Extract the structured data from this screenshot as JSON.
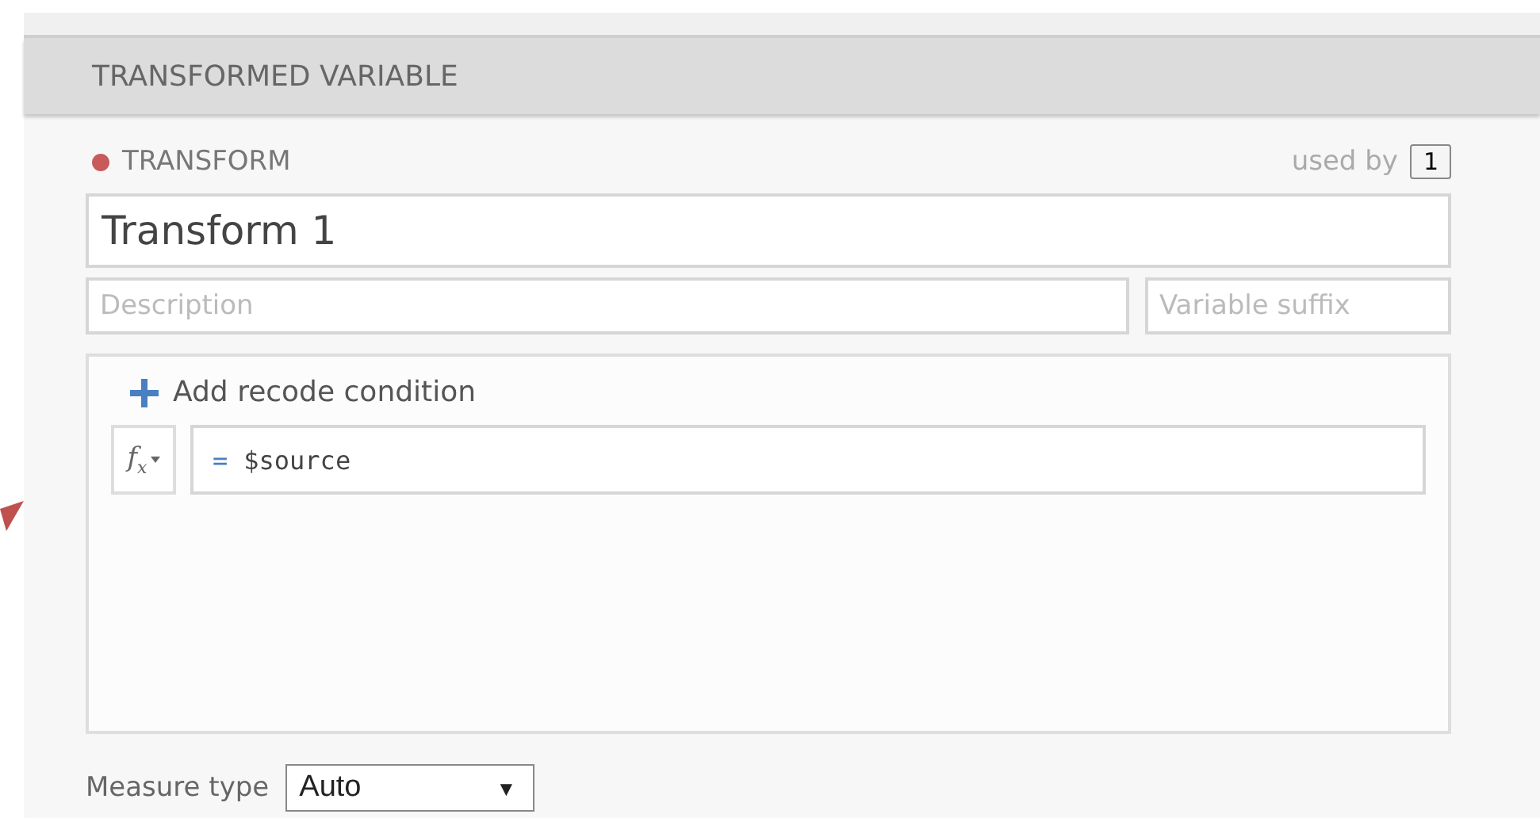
{
  "section": {
    "title": "TRANSFORMED VARIABLE"
  },
  "transform": {
    "label": "TRANSFORM",
    "used_by_label": "used by",
    "used_by_count": "1"
  },
  "name_field": {
    "value": "Transform 1"
  },
  "description_field": {
    "placeholder": "Description"
  },
  "suffix_field": {
    "placeholder": "Variable suffix"
  },
  "conditions": {
    "add_label": "Add recode condition",
    "fx_label": "f",
    "fx_sub": "x",
    "formulas": [
      {
        "operator": "=",
        "value": "$source"
      }
    ]
  },
  "measure_type": {
    "label": "Measure type",
    "value": "Auto",
    "arrow": "▼"
  }
}
